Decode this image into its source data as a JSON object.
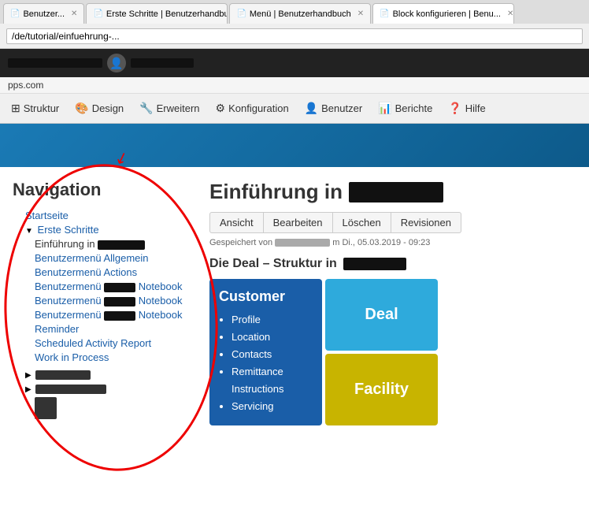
{
  "browser": {
    "tabs": [
      {
        "id": "tab1",
        "label": "Benutzer...",
        "active": false,
        "icon": "📄"
      },
      {
        "id": "tab2",
        "label": "Erste Schritte | Benutzerhandbu...",
        "active": false,
        "icon": "📄"
      },
      {
        "id": "tab3",
        "label": "Menü | Benutzerhandbuch",
        "active": false,
        "icon": "📄"
      },
      {
        "id": "tab4",
        "label": "Block konfigurieren | Benu...",
        "active": true,
        "icon": "📄"
      }
    ],
    "address": "/de/tutorial/einfuehrung-..."
  },
  "site_domain": "pps.com",
  "main_nav": {
    "items": [
      {
        "label": "Struktur",
        "icon": "⊞"
      },
      {
        "label": "Design",
        "icon": "🎨"
      },
      {
        "label": "Erweitern",
        "icon": "🔧"
      },
      {
        "label": "Konfiguration",
        "icon": "⚙"
      },
      {
        "label": "Benutzer",
        "icon": "👤"
      },
      {
        "label": "Berichte",
        "icon": "📊"
      },
      {
        "label": "Hilfe",
        "icon": "❓"
      }
    ]
  },
  "navigation_sidebar": {
    "title": "Navigation",
    "links": [
      {
        "text": "Startseite",
        "level": 1,
        "type": "link"
      },
      {
        "text": "Erste Schritte",
        "level": 1,
        "type": "link",
        "arrow": "▼"
      },
      {
        "text": "Einführung in",
        "level": 2,
        "type": "active",
        "redacted": true
      },
      {
        "text": "Benutzermenü Allgemein",
        "level": 2,
        "type": "link"
      },
      {
        "text": "Benutzermenü Actions",
        "level": 2,
        "type": "link"
      },
      {
        "text": "Benutzermenü",
        "level": 2,
        "type": "link",
        "suffix": "Notebook",
        "redacted": true
      },
      {
        "text": "Benutzermenü",
        "level": 2,
        "type": "link",
        "suffix": "Notebook",
        "redacted": true
      },
      {
        "text": "Benutzermenü",
        "level": 2,
        "type": "link",
        "suffix": "Notebook",
        "redacted": true
      },
      {
        "text": "Reminder",
        "level": 2,
        "type": "link"
      },
      {
        "text": "Scheduled Activity Report",
        "level": 2,
        "type": "link"
      },
      {
        "text": "Work in Process",
        "level": 2,
        "type": "link"
      }
    ]
  },
  "page": {
    "title_prefix": "Einführung in",
    "action_buttons": [
      "Ansicht",
      "Bearbeiten",
      "Löschen",
      "Revisionen"
    ],
    "save_info_prefix": "Gespeichert von",
    "save_info_suffix": "m Di., 05.03.2019 - 09:23",
    "section_title_prefix": "Die Deal – Struktur in",
    "deal_diagram": {
      "customer_box": {
        "title": "Customer",
        "items": [
          "Profile",
          "Location",
          "Contacts",
          "Remittance Instructions",
          "Servicing"
        ]
      },
      "deal_box": {
        "title": "Deal"
      },
      "facility_box": {
        "title": "Facility"
      }
    }
  }
}
